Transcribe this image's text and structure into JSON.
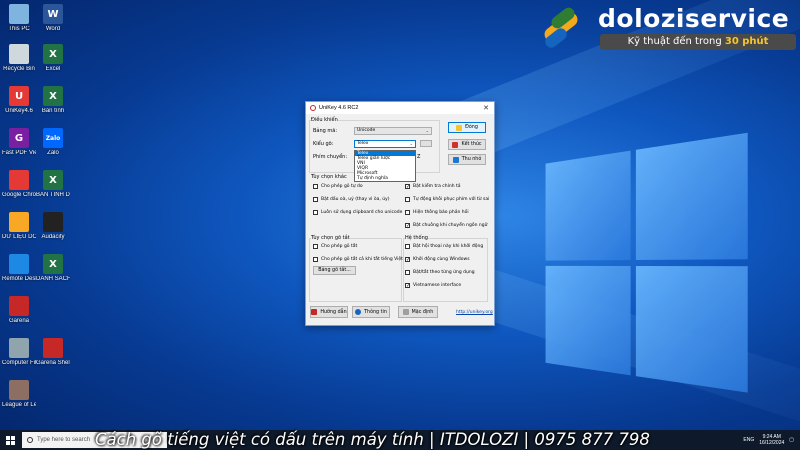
{
  "desktop": {
    "icons": [
      {
        "label": "This PC",
        "color": "#7fb3e0"
      },
      {
        "label": "Word",
        "color": "#2b579a",
        "glyph": "W"
      },
      {
        "label": "Recycle Bin",
        "color": "#cfd8dc"
      },
      {
        "label": "Excel",
        "color": "#217346",
        "glyph": "X"
      },
      {
        "label": "UniKey4.6",
        "color": "#e53935",
        "glyph": "U"
      },
      {
        "label": "Bàn tính",
        "color": "#217346",
        "glyph": "X"
      },
      {
        "label": "Fast PDF Viewer",
        "color": "#7b1fa2",
        "glyph": "G"
      },
      {
        "label": "Zalo",
        "color": "#0068ff",
        "glyph": "Zalo"
      },
      {
        "label": "Google Chrome",
        "color": "#e53935"
      },
      {
        "label": "BẢN TÍNH DOZOZI",
        "color": "#217346",
        "glyph": "X"
      },
      {
        "label": "DỮ LIỆU DOLOZI",
        "color": "#f9a825"
      },
      {
        "label": "Audacity",
        "color": "#222222"
      },
      {
        "label": "Remote Desktop",
        "color": "#1e88e5"
      },
      {
        "label": "DANH SÁCH",
        "color": "#217346",
        "glyph": "X"
      },
      {
        "label": "Garena",
        "color": "#c62828"
      },
      {
        "label": "Garena Shell",
        "color": "#c62828"
      },
      {
        "label": "Computer File",
        "color": "#90a4ae"
      },
      {
        "label": "League of Legends",
        "color": "#8d6e63"
      }
    ]
  },
  "brand": {
    "name": "doloziservice",
    "tagline_prefix": "Kỹ thuật đến trong ",
    "tagline_highlight": "30 phút"
  },
  "unikey": {
    "title": "UniKey 4.6 RC2",
    "section_control": "Điều khiển",
    "charset_label": "Bảng mã:",
    "charset_value": "Unicode",
    "method_label": "Kiểu gõ:",
    "method_value": "Telex",
    "hotkey_label": "Phím chuyển:",
    "hotkey_suffix": "Z",
    "method_options": [
      "Telex",
      "Telex giản lược",
      "VNI",
      "VIQR",
      "Microsoft",
      "Tự định nghĩa"
    ],
    "btn_close": "Đóng",
    "btn_exit": "Kết thúc",
    "btn_collapse": "Thu nhỏ",
    "section_options": "Tùy chọn khác",
    "left_options": [
      {
        "label": "Cho phép gõ tự do",
        "checked": false
      },
      {
        "label": "Bật dấu oà, uý (thay vì òa, úy)",
        "checked": false
      },
      {
        "label": "Luôn sử dụng clipboard cho unicode",
        "checked": false
      }
    ],
    "right_options": [
      {
        "label": "Bật kiểm tra chính tả",
        "checked": true
      },
      {
        "label": "Tự động khôi phục phím với từ sai",
        "checked": false
      },
      {
        "label": "Hiện thông báo phản hồi",
        "checked": false
      },
      {
        "label": "Bật chuông khi chuyển ngôn ngữ",
        "checked": true
      }
    ],
    "section_macro": "Tùy chọn gõ tắt",
    "macro_options": [
      {
        "label": "Cho phép gõ tắt",
        "checked": false
      },
      {
        "label": "Cho phép gõ tắt cả khi tắt tiếng Việt",
        "checked": false
      }
    ],
    "macro_table_btn": "Bảng gõ tắt...",
    "section_system": "Hệ thống",
    "system_options": [
      {
        "label": "Bật hội thoại này khi khởi động",
        "checked": false
      },
      {
        "label": "Khởi động cùng Windows",
        "checked": true
      },
      {
        "label": "Bật/tắt theo từng ứng dụng",
        "checked": false
      },
      {
        "label": "Vietnamese interface",
        "checked": true
      }
    ],
    "btn_help": "Hướng dẫn",
    "btn_info": "Thông tin",
    "btn_default": "Mặc định",
    "link": "http://unikey.org"
  },
  "taskbar": {
    "search_placeholder": "Type here to search",
    "caption": "Cách gõ tiếng việt có dấu trên máy tính | ITDOLOZI | 0975 877 798",
    "lang": "ENG",
    "time": "9:24 AM",
    "date": "16/12/2024"
  }
}
